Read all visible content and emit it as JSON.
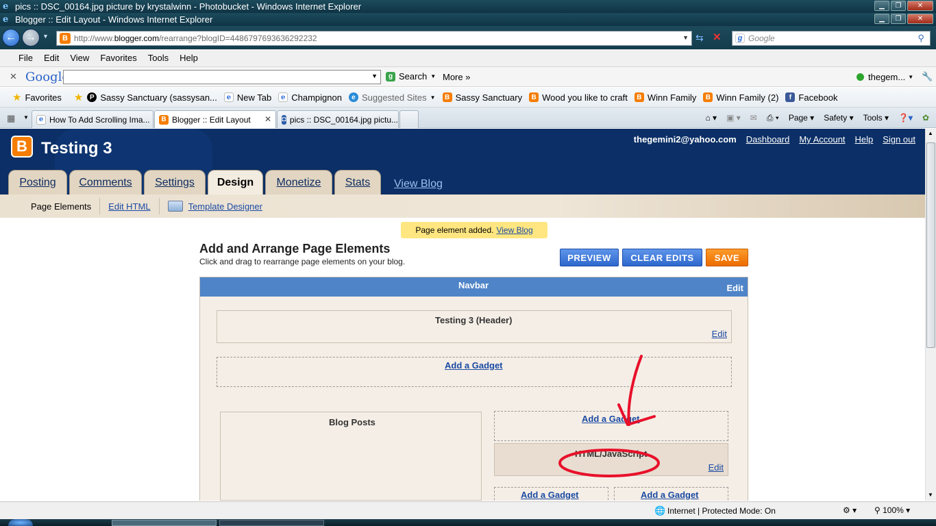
{
  "windows": {
    "title1": "pics :: DSC_00164.jpg picture by krystalwinn - Photobucket - Windows Internet Explorer",
    "title2": "Blogger :: Edit Layout - Windows Internet Explorer"
  },
  "address": {
    "prefix": "http://www.",
    "domain": "blogger.com",
    "path": "/rearrange?blogID=4486797693636292232",
    "search_placeholder": "Google"
  },
  "menu": [
    "File",
    "Edit",
    "View",
    "Favorites",
    "Tools",
    "Help"
  ],
  "google_toolbar": {
    "logo": "Google",
    "search_label": "Search",
    "more_label": "More »",
    "account": "thegem..."
  },
  "favorites": {
    "label": "Favorites",
    "items": [
      "Sassy Sanctuary (sassysan...",
      "New Tab",
      "Champignon",
      "Suggested Sites",
      "Sassy Sanctuary",
      "Wood you like to craft",
      "Winn Family",
      "Winn Family (2)",
      "Facebook"
    ]
  },
  "tabs": [
    "How To Add Scrolling Ima...",
    "Blogger :: Edit Layout",
    "pics :: DSC_00164.jpg pictu..."
  ],
  "commands": [
    "Page",
    "Safety",
    "Tools"
  ],
  "blog": {
    "title": "Testing 3",
    "email": "thegemini2@yahoo.com",
    "links": [
      "Dashboard",
      "My Account",
      "Help",
      "Sign out"
    ],
    "tabs": [
      "Posting",
      "Comments",
      "Settings",
      "Design",
      "Monetize",
      "Stats"
    ],
    "view_blog": "View Blog",
    "subnav": [
      "Page Elements",
      "Edit HTML",
      "Template Designer"
    ]
  },
  "notice": {
    "text": "Page element added.",
    "link": "View Blog"
  },
  "layout": {
    "heading": "Add and Arrange Page Elements",
    "subheading": "Click and drag to rearrange page elements on your blog.",
    "preview": "PREVIEW",
    "clear": "CLEAR EDITS",
    "save": "SAVE",
    "navbar": "Navbar",
    "edit": "Edit",
    "header": "Testing 3 (Header)",
    "add_gadget": "Add a Gadget",
    "blog_posts": "Blog Posts",
    "html_js": "HTML/JavaScript"
  },
  "status": {
    "zone": "Internet | Protected Mode: On",
    "zoom": "100%"
  },
  "colors": {
    "blogger_navy": "#0b2f66",
    "blogger_orange": "#f57d00",
    "annotation_red": "#e8102a"
  }
}
